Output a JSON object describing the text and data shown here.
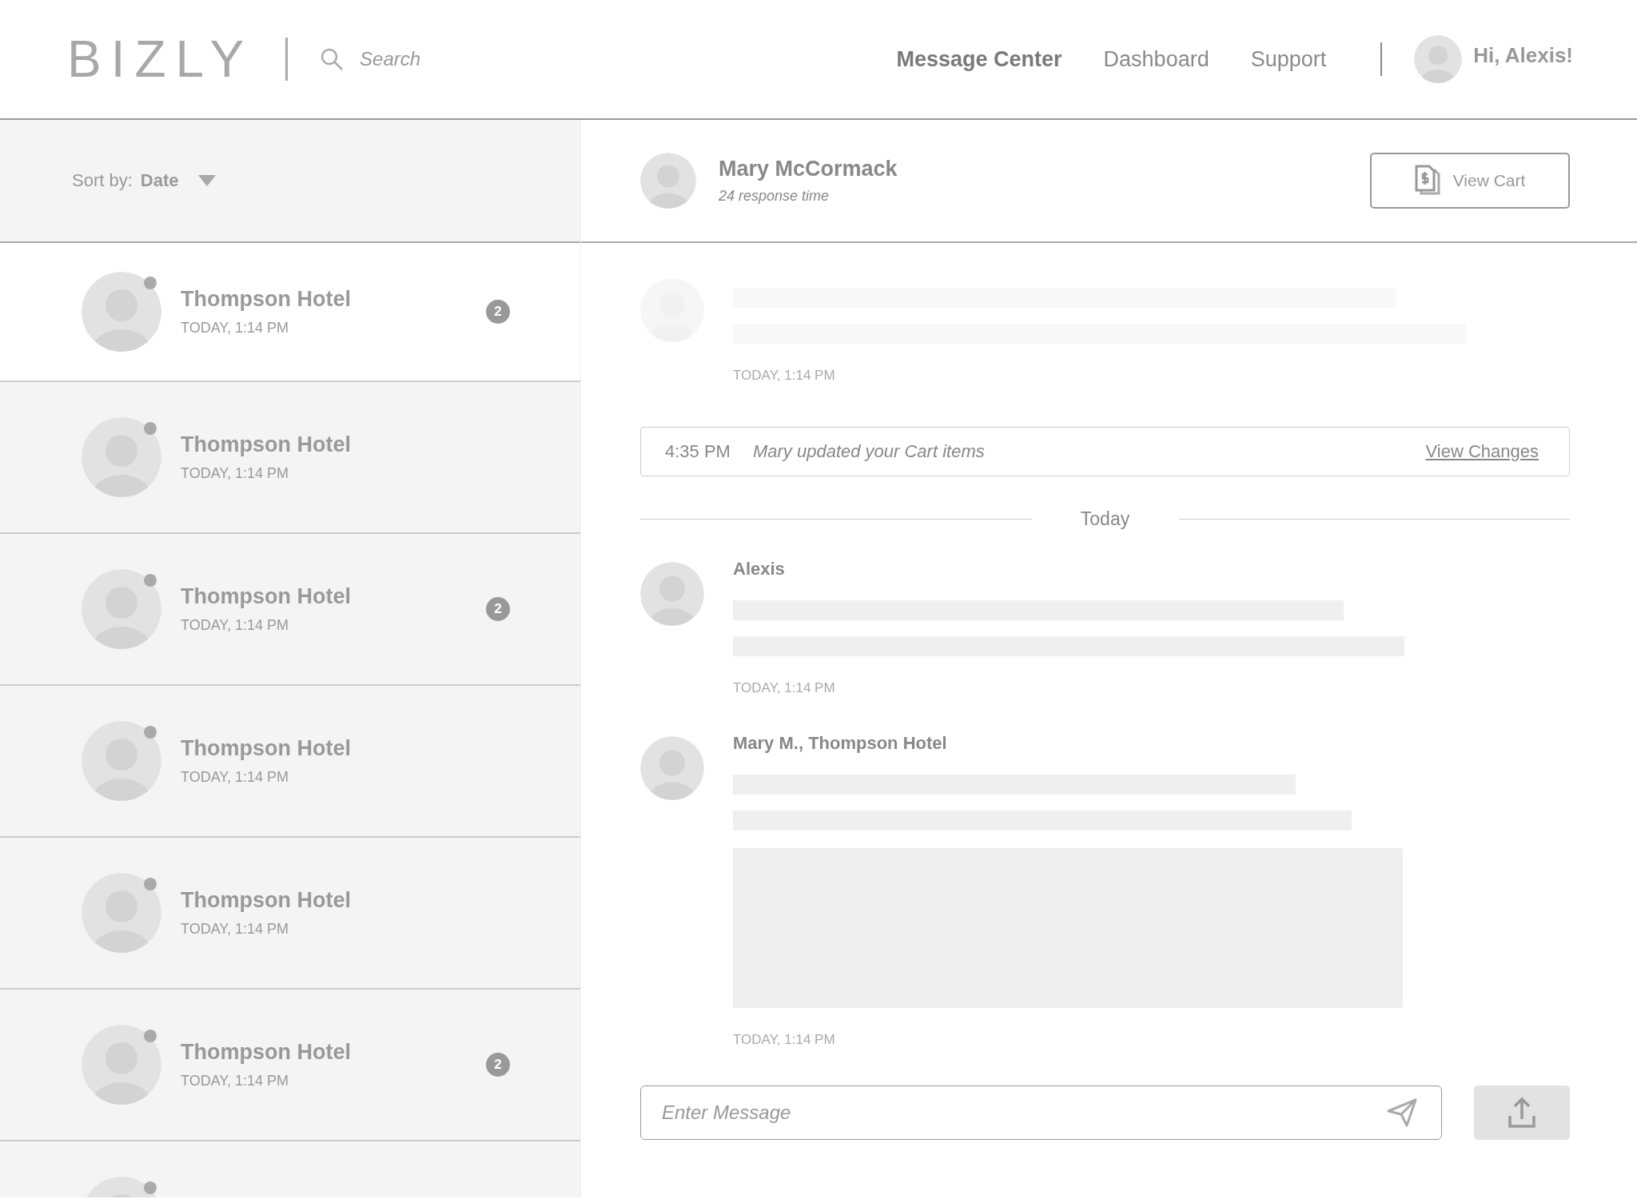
{
  "header": {
    "logo": "BIZLY",
    "search": {
      "placeholder": "Search"
    },
    "nav": [
      {
        "label": "Message Center",
        "selected": true
      },
      {
        "label": "Dashboard",
        "selected": false
      },
      {
        "label": "Support",
        "selected": false
      }
    ],
    "greeting": "Hi, Alexis!"
  },
  "sidebar": {
    "sort_label": "Sort by:",
    "sort_value": "Date",
    "conversations": [
      {
        "kind": "full",
        "name": "Thompson Hotel",
        "time": "TODAY, 1:14 PM",
        "badge": "2",
        "selected": true
      },
      {
        "kind": "full",
        "name": "Thompson Hotel",
        "time": "TODAY, 1:14 PM",
        "selected": false
      },
      {
        "kind": "full",
        "name": "Thompson Hotel",
        "time": "TODAY, 1:14 PM",
        "badge": "2",
        "selected": false
      },
      {
        "kind": "full",
        "name": "Thompson Hotel",
        "time": "TODAY, 1:14 PM",
        "selected": false
      },
      {
        "kind": "full",
        "name": "Thompson Hotel",
        "time": "TODAY, 1:14 PM",
        "selected": false
      },
      {
        "kind": "full",
        "name": "Thompson Hotel",
        "time": "TODAY, 1:14 PM",
        "badge": "2",
        "selected": false
      },
      {
        "kind": "cut_off",
        "selected": false
      }
    ]
  },
  "chat": {
    "contact": "Mary McCormack",
    "response_time": "24 response time",
    "view_cart": "View Cart",
    "messages": [
      {
        "kind": "faded",
        "time": "TODAY, 1:14 PM"
      },
      {
        "kind": "notice",
        "time": "4:35 PM",
        "text": "Mary updated your Cart items",
        "link": "View Changes"
      },
      {
        "kind": "divider",
        "label": "Today"
      },
      {
        "kind": "message",
        "author": "Alexis",
        "time": "TODAY, 1:14 PM",
        "attachment": false
      },
      {
        "kind": "message",
        "author": "Mary M., Thompson Hotel",
        "time": "TODAY, 1:14 PM",
        "attachment": true
      }
    ],
    "compose": {
      "placeholder": "Enter Message"
    }
  }
}
